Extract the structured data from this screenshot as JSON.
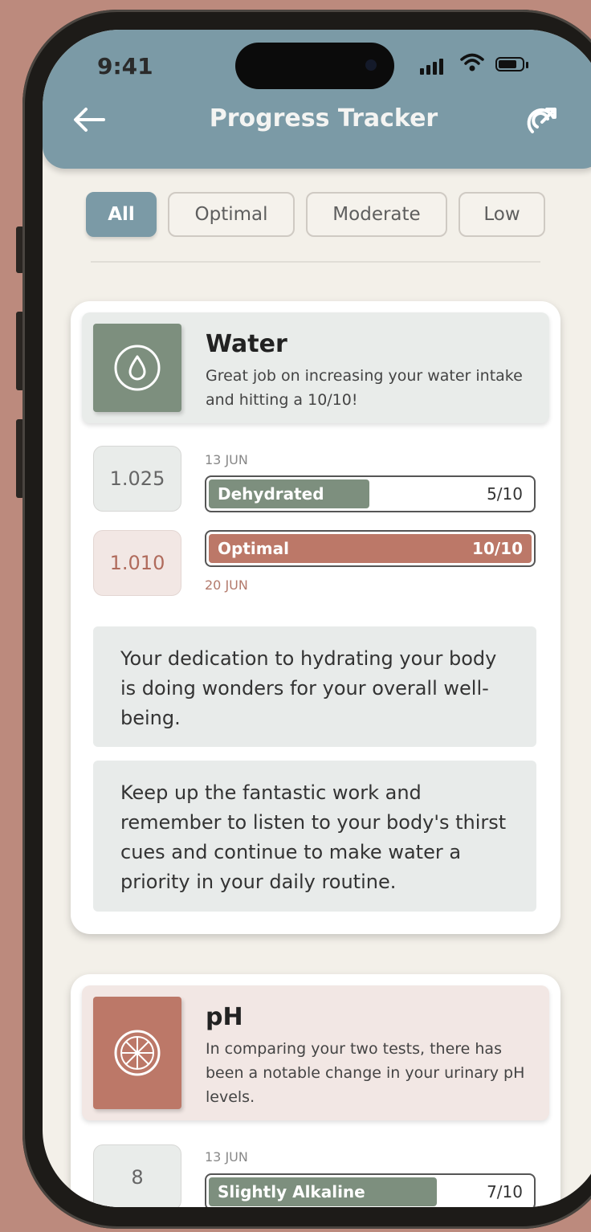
{
  "status_bar": {
    "time": "9:41"
  },
  "header": {
    "title": "Progress Tracker",
    "back_icon": "arrow-left-icon",
    "action_icon": "share-arrow-icon"
  },
  "filters": [
    {
      "label": "All",
      "active": true
    },
    {
      "label": "Optimal",
      "active": false
    },
    {
      "label": "Moderate",
      "active": false
    },
    {
      "label": "Low",
      "active": false
    }
  ],
  "cards": [
    {
      "title": "Water",
      "icon": "water-drop-icon",
      "icon_color": "#7d8f7e",
      "description": "Great job on increasing your water intake and hitting a 10/10!",
      "readings": [
        {
          "value": "1.025",
          "date": "13 JUN",
          "status": "Dehydrated",
          "score": "5/10",
          "fill": 0.5,
          "color": "#7d8f7e"
        },
        {
          "value": "1.010",
          "date": "20 JUN",
          "status": "Optimal",
          "score": "10/10",
          "fill": 1.0,
          "color": "#bc7868"
        }
      ],
      "messages": [
        "Your dedication to hydrating your body is doing wonders for your overall well-being.",
        "Keep up the fantastic work and remember to listen to your body's thirst cues and continue to make water a priority in your daily routine."
      ]
    },
    {
      "title": "pH",
      "icon": "citrus-slice-icon",
      "icon_color": "#bc7868",
      "description": "In comparing your two tests, there has been a notable change in your urinary pH levels.",
      "readings": [
        {
          "value": "8",
          "date": "13 JUN",
          "status": "Slightly Alkaline",
          "score": "7/10",
          "fill": 0.7,
          "color": "#7d8f7e"
        }
      ]
    }
  ]
}
